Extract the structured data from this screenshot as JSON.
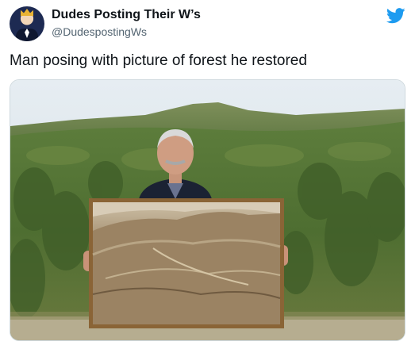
{
  "tweet": {
    "display_name": "Dudes Posting Their W’s",
    "handle": "@DudespostingWs",
    "text": "Man posing with picture of forest he restored",
    "avatar_icon": "crowned-man-avatar",
    "platform_icon": "twitter-bird-icon",
    "accent_color": "#1d9bf0"
  }
}
